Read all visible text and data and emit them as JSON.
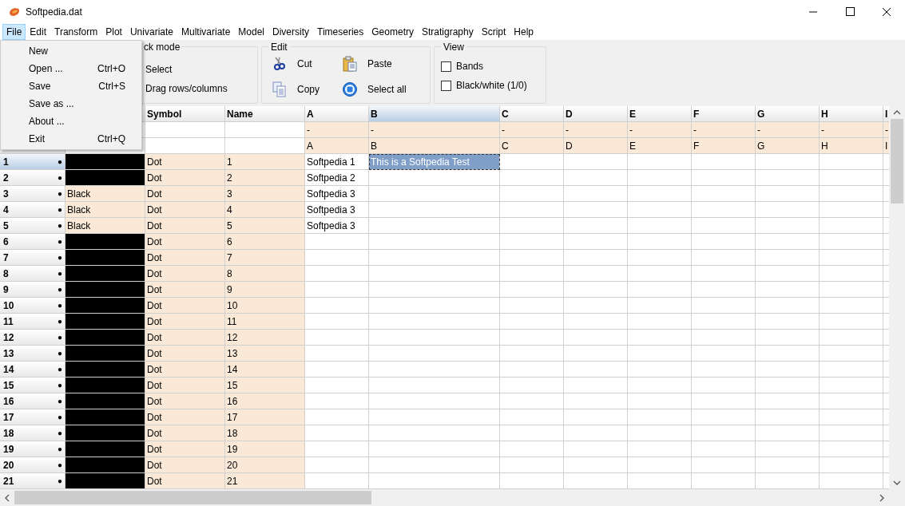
{
  "window": {
    "title": "Softpedia.dat"
  },
  "menubar": [
    {
      "label": "File",
      "selected": true
    },
    {
      "label": "Edit",
      "selected": false
    },
    {
      "label": "Transform",
      "selected": false
    },
    {
      "label": "Plot",
      "selected": false
    },
    {
      "label": "Univariate",
      "selected": false
    },
    {
      "label": "Multivariate",
      "selected": false
    },
    {
      "label": "Model",
      "selected": false
    },
    {
      "label": "Diversity",
      "selected": false
    },
    {
      "label": "Timeseries",
      "selected": false
    },
    {
      "label": "Geometry",
      "selected": false
    },
    {
      "label": "Stratigraphy",
      "selected": false
    },
    {
      "label": "Script",
      "selected": false
    },
    {
      "label": "Help",
      "selected": false
    }
  ],
  "file_menu": [
    {
      "label": "New"
    },
    {
      "label": "Open ...",
      "shortcut": "Ctrl+O"
    },
    {
      "label": "Save",
      "shortcut": "Ctrl+S"
    },
    {
      "label": "Save as ..."
    },
    {
      "label": "About ..."
    },
    {
      "label": "Exit",
      "shortcut": "Ctrl+Q"
    }
  ],
  "toolbar": {
    "click_mode": {
      "title": "ck mode",
      "options": [
        "Select",
        "Drag rows/columns"
      ]
    },
    "edit": {
      "title": "Edit",
      "buttons": [
        {
          "kind": "cut",
          "label": "Cut"
        },
        {
          "kind": "paste",
          "label": "Paste"
        },
        {
          "kind": "copy",
          "label": "Copy"
        },
        {
          "kind": "select_all",
          "label": "Select all"
        }
      ]
    },
    "view": {
      "title": "View",
      "checkboxes": [
        {
          "label": "Bands",
          "checked": false
        },
        {
          "label": "Black/white (1/0)",
          "checked": false
        }
      ]
    }
  },
  "table": {
    "fixed_columns": [
      "Symbol",
      "Name"
    ],
    "columns": [
      {
        "header": "A",
        "attr_1": "-",
        "attr_2": "A",
        "selected": false
      },
      {
        "header": "B",
        "attr_1": "-",
        "attr_2": "B",
        "selected": true
      },
      {
        "header": "C",
        "attr_1": "-",
        "attr_2": "C",
        "selected": false
      },
      {
        "header": "D",
        "attr_1": "-",
        "attr_2": "D",
        "selected": false
      },
      {
        "header": "E",
        "attr_1": "-",
        "attr_2": "E",
        "selected": false
      },
      {
        "header": "F",
        "attr_1": "-",
        "attr_2": "F",
        "selected": false
      },
      {
        "header": "G",
        "attr_1": "-",
        "attr_2": "G",
        "selected": false
      },
      {
        "header": "H",
        "attr_1": "-",
        "attr_2": "H",
        "selected": false
      },
      {
        "header": "I",
        "attr_1": "-",
        "attr_2": "I",
        "selected": false
      }
    ],
    "rows": [
      {
        "number": "1",
        "marker": "●",
        "selected": true,
        "colour": {
          "kind": "swatch",
          "color": "#000000"
        },
        "symbol": "Dot",
        "name": "1",
        "cells": [
          {
            "text": "Softpedia 1",
            "selected": false
          },
          {
            "text": "This is a Softpedia Test",
            "selected": true
          }
        ]
      },
      {
        "number": "2",
        "marker": "●",
        "selected": false,
        "colour": {
          "kind": "swatch",
          "color": "#000000"
        },
        "symbol": "Dot",
        "name": "2",
        "cells": [
          {
            "text": "Softpedia 2",
            "selected": false
          }
        ]
      },
      {
        "number": "3",
        "marker": "●",
        "selected": false,
        "colour": {
          "kind": "text",
          "text": "Black"
        },
        "symbol": "Dot",
        "name": "3",
        "cells": [
          {
            "text": "Softpedia 3",
            "selected": false
          }
        ]
      },
      {
        "number": "4",
        "marker": "●",
        "selected": false,
        "colour": {
          "kind": "text",
          "text": "Black"
        },
        "symbol": "Dot",
        "name": "4",
        "cells": [
          {
            "text": "Softpedia 3",
            "selected": false
          }
        ]
      },
      {
        "number": "5",
        "marker": "●",
        "selected": false,
        "colour": {
          "kind": "text",
          "text": "Black"
        },
        "symbol": "Dot",
        "name": "5",
        "cells": [
          {
            "text": "Softpedia 3",
            "selected": false
          }
        ]
      },
      {
        "number": "6",
        "marker": "●",
        "selected": false,
        "colour": {
          "kind": "swatch",
          "color": "#000000"
        },
        "symbol": "Dot",
        "name": "6"
      },
      {
        "number": "7",
        "marker": "●",
        "selected": false,
        "colour": {
          "kind": "swatch",
          "color": "#000000"
        },
        "symbol": "Dot",
        "name": "7"
      },
      {
        "number": "8",
        "marker": "●",
        "selected": false,
        "colour": {
          "kind": "swatch",
          "color": "#000000"
        },
        "symbol": "Dot",
        "name": "8"
      },
      {
        "number": "9",
        "marker": "●",
        "selected": false,
        "colour": {
          "kind": "swatch",
          "color": "#000000"
        },
        "symbol": "Dot",
        "name": "9"
      },
      {
        "number": "10",
        "marker": "●",
        "selected": false,
        "colour": {
          "kind": "swatch",
          "color": "#000000"
        },
        "symbol": "Dot",
        "name": "10"
      },
      {
        "number": "11",
        "marker": "●",
        "selected": false,
        "colour": {
          "kind": "swatch",
          "color": "#000000"
        },
        "symbol": "Dot",
        "name": "11"
      },
      {
        "number": "12",
        "marker": "●",
        "selected": false,
        "colour": {
          "kind": "swatch",
          "color": "#000000"
        },
        "symbol": "Dot",
        "name": "12"
      },
      {
        "number": "13",
        "marker": "●",
        "selected": false,
        "colour": {
          "kind": "swatch",
          "color": "#000000"
        },
        "symbol": "Dot",
        "name": "13"
      },
      {
        "number": "14",
        "marker": "●",
        "selected": false,
        "colour": {
          "kind": "swatch",
          "color": "#000000"
        },
        "symbol": "Dot",
        "name": "14"
      },
      {
        "number": "15",
        "marker": "●",
        "selected": false,
        "colour": {
          "kind": "swatch",
          "color": "#000000"
        },
        "symbol": "Dot",
        "name": "15"
      },
      {
        "number": "16",
        "marker": "●",
        "selected": false,
        "colour": {
          "kind": "swatch",
          "color": "#000000"
        },
        "symbol": "Dot",
        "name": "16"
      },
      {
        "number": "17",
        "marker": "●",
        "selected": false,
        "colour": {
          "kind": "swatch",
          "color": "#000000"
        },
        "symbol": "Dot",
        "name": "17"
      },
      {
        "number": "18",
        "marker": "●",
        "selected": false,
        "colour": {
          "kind": "swatch",
          "color": "#000000"
        },
        "symbol": "Dot",
        "name": "18"
      },
      {
        "number": "19",
        "marker": "●",
        "selected": false,
        "colour": {
          "kind": "swatch",
          "color": "#000000"
        },
        "symbol": "Dot",
        "name": "19"
      },
      {
        "number": "20",
        "marker": "●",
        "selected": false,
        "colour": {
          "kind": "swatch",
          "color": "#000000"
        },
        "symbol": "Dot",
        "name": "20"
      },
      {
        "number": "21",
        "marker": "●",
        "selected": false,
        "colour": {
          "kind": "swatch",
          "color": "#000000"
        },
        "symbol": "Dot",
        "name": "21"
      }
    ]
  }
}
